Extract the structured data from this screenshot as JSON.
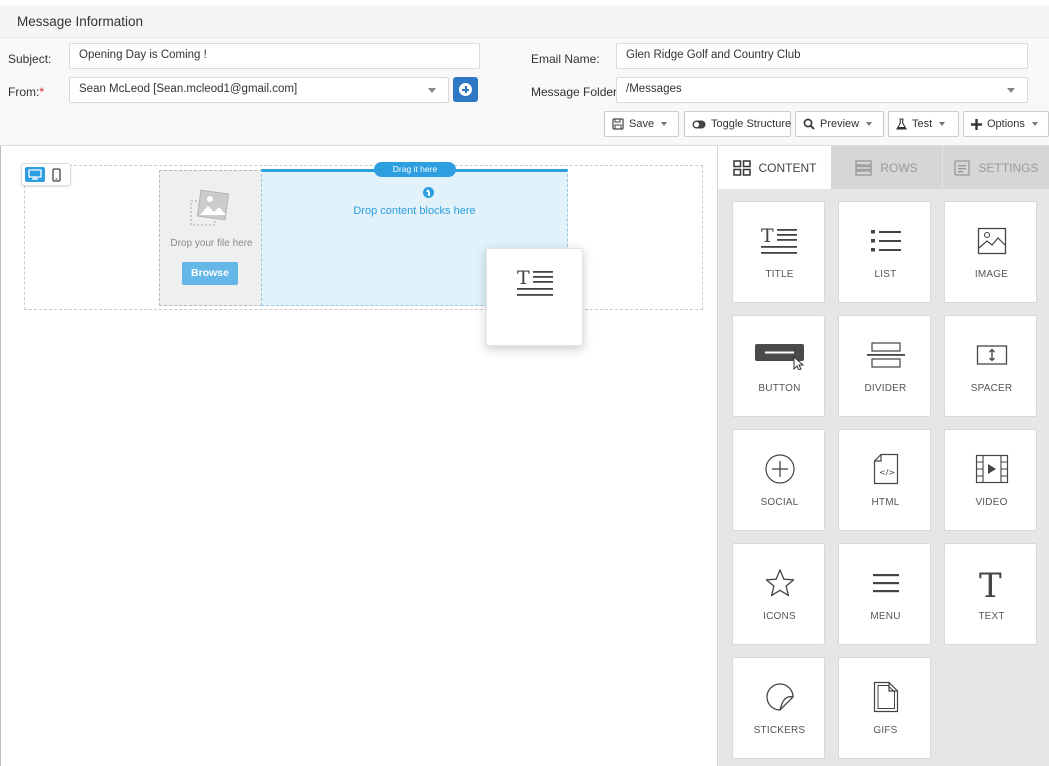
{
  "header": {
    "title": "Message Information"
  },
  "form": {
    "subject_label": "Subject:",
    "subject_value": "Opening Day is Coming !",
    "from_label": "From:",
    "from_required_marker": "*",
    "from_value": "Sean McLeod  [Sean.mcleod1@gmail.com]",
    "email_name_label": "Email Name:",
    "email_name_value": "Glen Ridge Golf and Country Club",
    "folder_label": "Message Folder:",
    "folder_value": "/Messages"
  },
  "toolbar": {
    "save": "Save",
    "toggle": "Toggle Structure",
    "preview": "Preview",
    "test": "Test",
    "options": "Options"
  },
  "canvas": {
    "drop_file_text": "Drop your file here",
    "browse_label": "Browse",
    "drag_here": "Drag it here",
    "drop_blocks_text": "Drop content blocks here"
  },
  "sidebar": {
    "tabs": [
      {
        "label": "CONTENT",
        "active": true
      },
      {
        "label": "ROWS",
        "active": false
      },
      {
        "label": "SETTINGS",
        "active": false
      }
    ],
    "tiles": [
      {
        "label": "TITLE",
        "icon": "title-icon"
      },
      {
        "label": "LIST",
        "icon": "list-icon"
      },
      {
        "label": "IMAGE",
        "icon": "image-icon"
      },
      {
        "label": "BUTTON",
        "icon": "button-icon"
      },
      {
        "label": "DIVIDER",
        "icon": "divider-icon"
      },
      {
        "label": "SPACER",
        "icon": "spacer-icon"
      },
      {
        "label": "SOCIAL",
        "icon": "social-icon"
      },
      {
        "label": "HTML",
        "icon": "html-icon"
      },
      {
        "label": "VIDEO",
        "icon": "video-icon"
      },
      {
        "label": "ICONS",
        "icon": "star-icon"
      },
      {
        "label": "MENU",
        "icon": "menu-icon"
      },
      {
        "label": "TEXT",
        "icon": "text-icon"
      },
      {
        "label": "STICKERS",
        "icon": "sticker-icon"
      },
      {
        "label": "GIFS",
        "icon": "gif-icon"
      }
    ]
  },
  "colors": {
    "accent": "#2d9ee0",
    "add_button": "#2f77c4",
    "required": "#e02828",
    "drop_zone": "#e1f2fa"
  }
}
